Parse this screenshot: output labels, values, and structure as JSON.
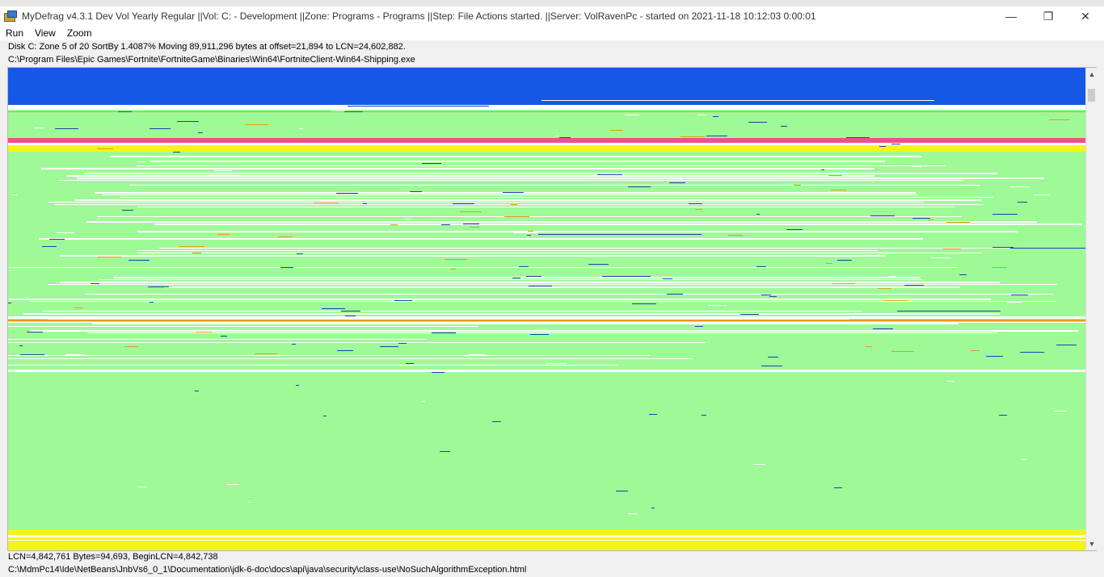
{
  "window": {
    "title": "MyDefrag v4.3.1   Dev Vol Yearly Regular ||Vol: C: - Development ||Zone: Programs - Programs ||Step: File Actions started. ||Server: VolRavenPc -  started on 2021-11-18 10:12:03 0:00:01",
    "minimize_glyph": "—",
    "restore_glyph": "❐",
    "close_glyph": "✕"
  },
  "menu": {
    "items": [
      "Run",
      "View",
      "Zoom"
    ]
  },
  "status": {
    "progress_line": "Disk C:    Zone 5 of 20   SortBy   1.4087%   Moving 89,911,296 bytes at offset=21,894 to LCN=24,602,882.",
    "current_file": "C:\\Program Files\\Epic Games\\Fortnite\\FortniteGame\\Binaries\\Win64\\FortniteClient-Win64-Shipping.exe",
    "hover_info": "LCN=4,842,761     Bytes=94,693, BeginLCN=4,842,738",
    "hover_file": "C:\\MdmPc14\\Ide\\NetBeans\\JnbVs6_0_1\\Documentation\\jdk-6-doc\\docs\\api\\java\\security\\class-use\\NoSuchAlgorithmException.html"
  },
  "diskmap": {
    "legend_colors": {
      "free": "#9efa96",
      "blue_zone": "#1658e6",
      "pink": "#f24f8e",
      "yellow": "#f4f41a",
      "white": "#ffffff",
      "orange": "#e89a1a",
      "dark_blue": "#1c3fb0"
    }
  },
  "scrollbar": {
    "up_glyph": "▲",
    "down_glyph": "▼"
  }
}
